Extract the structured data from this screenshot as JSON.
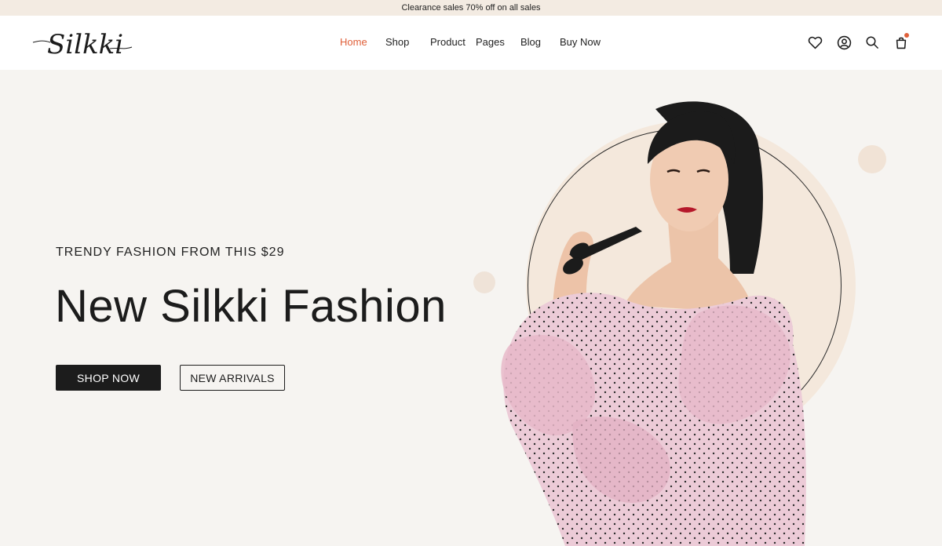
{
  "announcement": {
    "text": "Clearance sales 70% off on all sales"
  },
  "brand": {
    "logo_text": "Silkki"
  },
  "nav": {
    "items": [
      {
        "label": "Home",
        "active": true
      },
      {
        "label": "Shop",
        "active": false
      },
      {
        "label": "Product",
        "active": false
      },
      {
        "label": "Pages",
        "active": false
      },
      {
        "label": "Blog",
        "active": false
      },
      {
        "label": "Buy Now",
        "active": false
      }
    ]
  },
  "header_icons": [
    "heart-icon",
    "user-icon",
    "search-icon",
    "cart-icon"
  ],
  "hero": {
    "subtitle": "TRENDY FASHION FROM THIS $29",
    "title": "New Silkki Fashion",
    "primary_button": "SHOP NOW",
    "secondary_button": "NEW ARRIVALS"
  },
  "colors": {
    "accent": "#e0603a",
    "announcement_bg": "#f3ebe2",
    "hero_bg": "#f6f4f1",
    "circle": "#f4e8dc",
    "button_dark": "#1c1c1c",
    "dress": "#e9c6d3"
  }
}
